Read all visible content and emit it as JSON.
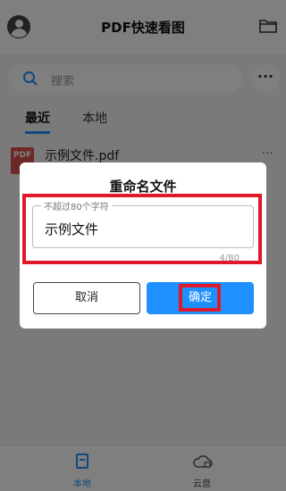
{
  "header": {
    "title": "PDF快速看图",
    "avatar_icon": "user-avatar-icon",
    "folder_icon": "folder-icon"
  },
  "search": {
    "placeholder": "搜索",
    "icon": "search-icon",
    "more_label": "···"
  },
  "tabs": [
    {
      "label": "最近",
      "active": true
    },
    {
      "label": "本地",
      "active": false
    }
  ],
  "file_list": [
    {
      "icon_text": "PDF",
      "name": "示例文件.pdf",
      "more": "···"
    }
  ],
  "dialog": {
    "title": "重命名文件",
    "input_legend": "不超过80个字符",
    "input_value": "示例文件",
    "char_count": "4/80",
    "cancel_label": "取消",
    "confirm_label": "确定"
  },
  "bottom_nav": [
    {
      "label": "本地",
      "icon": "document-icon",
      "active": true
    },
    {
      "label": "云盘",
      "icon": "cloud-icon",
      "active": false
    }
  ],
  "colors": {
    "accent": "#1e90ff",
    "highlight": "#e0192a",
    "overlay": "rgba(0,0,0,0.5)"
  }
}
